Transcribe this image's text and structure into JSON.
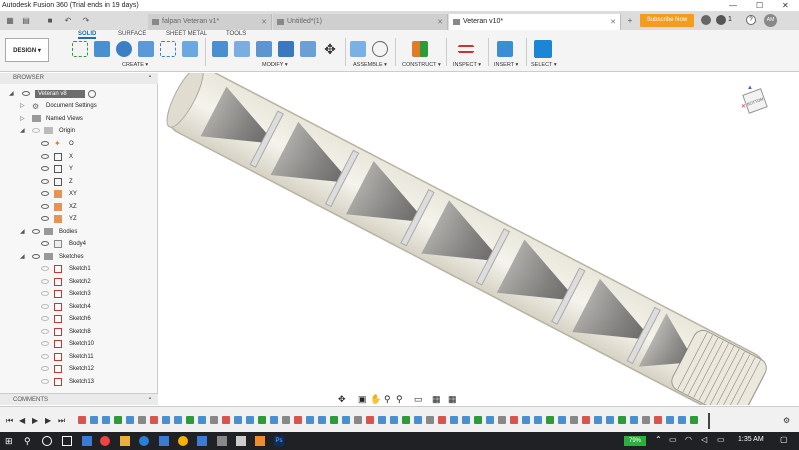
{
  "window": {
    "title": "Autodesk Fusion 360 (Trial ends in 19 days)"
  },
  "doc_tabs": [
    {
      "label": "falpan Veteran v1*"
    },
    {
      "label": "Untitled*(1)"
    },
    {
      "label": "Veteran v10*"
    }
  ],
  "header": {
    "subscribe_label": "Subscribe Now",
    "notifications": "1",
    "avatar": "AM",
    "help": "?"
  },
  "workspace": {
    "label": "DESIGN ▾"
  },
  "ws_tabs": [
    "SOLID",
    "SURFACE",
    "SHEET METAL",
    "TOOLS"
  ],
  "tool_groups": [
    "CREATE ▾",
    "MODIFY ▾",
    "ASSEMBLE ▾",
    "CONSTRUCT ▾",
    "INSPECT ▾",
    "INSERT ▾",
    "SELECT ▾"
  ],
  "browser": {
    "title": "BROWSER",
    "root": "Veteran v8",
    "document_settings": "Document Settings",
    "named_views": "Named Views",
    "origin": "Origin",
    "origin_items": [
      "O",
      "X",
      "Y",
      "Z",
      "XY",
      "XZ",
      "YZ"
    ],
    "bodies": "Bodies",
    "body_items": [
      "Body4"
    ],
    "sketches": "Sketches",
    "sketch_items": [
      "Sketch1",
      "Sketch2",
      "Sketch3",
      "Sketch4",
      "Sketch6",
      "Sketch8",
      "Sketch10",
      "Sketch11",
      "Sketch12",
      "Sketch13"
    ]
  },
  "comments": {
    "label": "COMMENTS"
  },
  "viewcube": {
    "face_label": "BOTTOM"
  },
  "taskbar": {
    "battery": "79%",
    "clock": "1:35 AM"
  },
  "colors": {
    "accent": "#1b6fb5",
    "subscribe": "#f39c1f",
    "taskbar": "#202125"
  }
}
